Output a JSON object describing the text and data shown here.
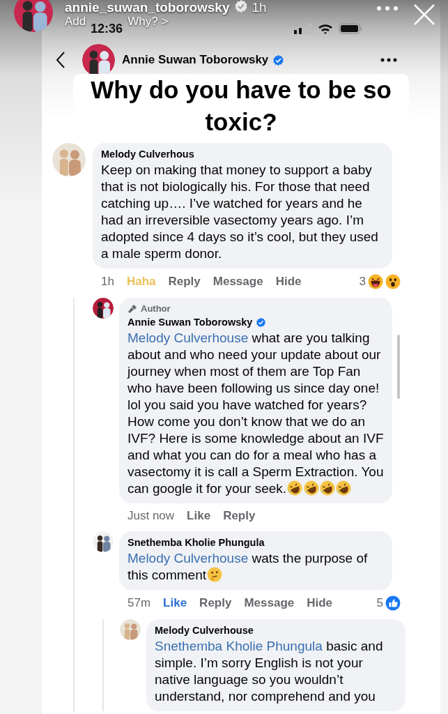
{
  "story": {
    "username": "annie_suwan_toborowsky",
    "verified": true,
    "age": "1h",
    "subtitle_start": "Add",
    "subtitle_end": "Why? >"
  },
  "status_bar": {
    "time": "12:36"
  },
  "post_header": {
    "name": "Annie Suwan Toborowsky",
    "verified": true
  },
  "caption": "Why do you have to be so toxic?",
  "comments": [
    {
      "author": "Melody Culverhous",
      "verified": false,
      "text": "Keep on making that money to support a baby that is not biologically his. For those that need catching up…. I’ve watched for years and he had an irreversible vasectomy years ago. I’m adopted since 4 days so it’s cool, but they used a male sperm donor.",
      "time": "1h",
      "actions": [
        {
          "label": "Haha",
          "kind": "haha",
          "selected": true
        },
        {
          "label": "Reply",
          "kind": "link"
        },
        {
          "label": "Message",
          "kind": "link"
        },
        {
          "label": "Hide",
          "kind": "link"
        }
      ],
      "reactions": {
        "count": "3",
        "icons": [
          {
            "kind": "haha"
          },
          {
            "kind": "wow"
          }
        ]
      },
      "children": [
        {
          "badge": "Author",
          "author": "Annie Suwan Toborowsky",
          "verified": true,
          "mention": "Melody Culverhouse",
          "text": "what are you talking about and who need your update about our journey when most of them are Top Fan who have been following us since day one! lol you said you have watched for years? How come you don’t know that we do an IVF? Here is some knowledge about an IVF and what you can do for a meal who has a vasectomy it is call a Sperm Extraction. You can google it for your seek.",
          "emojis": [
            {
              "kind": "rofl"
            },
            {
              "kind": "rofl"
            },
            {
              "kind": "rofl"
            },
            {
              "kind": "rofl"
            }
          ],
          "time": "Just now",
          "actions": [
            {
              "label": "Like",
              "kind": "like",
              "selected": false
            },
            {
              "label": "Reply",
              "kind": "link"
            }
          ]
        },
        {
          "author": "Snethemba Kholie Phungula",
          "verified": false,
          "mention": "Melody Culverhouse",
          "text": "wats the purpose of this comment",
          "emojis": [
            {
              "kind": "thinking"
            }
          ],
          "time": "57m",
          "actions": [
            {
              "label": "Like",
              "kind": "like",
              "selected": true
            },
            {
              "label": "Reply",
              "kind": "link"
            },
            {
              "label": "Message",
              "kind": "link"
            },
            {
              "label": "Hide",
              "kind": "link"
            }
          ],
          "reactions": {
            "count": "5",
            "icons": [
              {
                "kind": "like"
              }
            ]
          },
          "children": [
            {
              "author": "Melody Culverhouse",
              "verified": false,
              "mention": "Snethemba Kholie Phungula",
              "text": "basic and simple. I’m sorry English is not your native language so you wouldn’t understand, nor comprehend and you"
            }
          ]
        }
      ]
    }
  ]
}
